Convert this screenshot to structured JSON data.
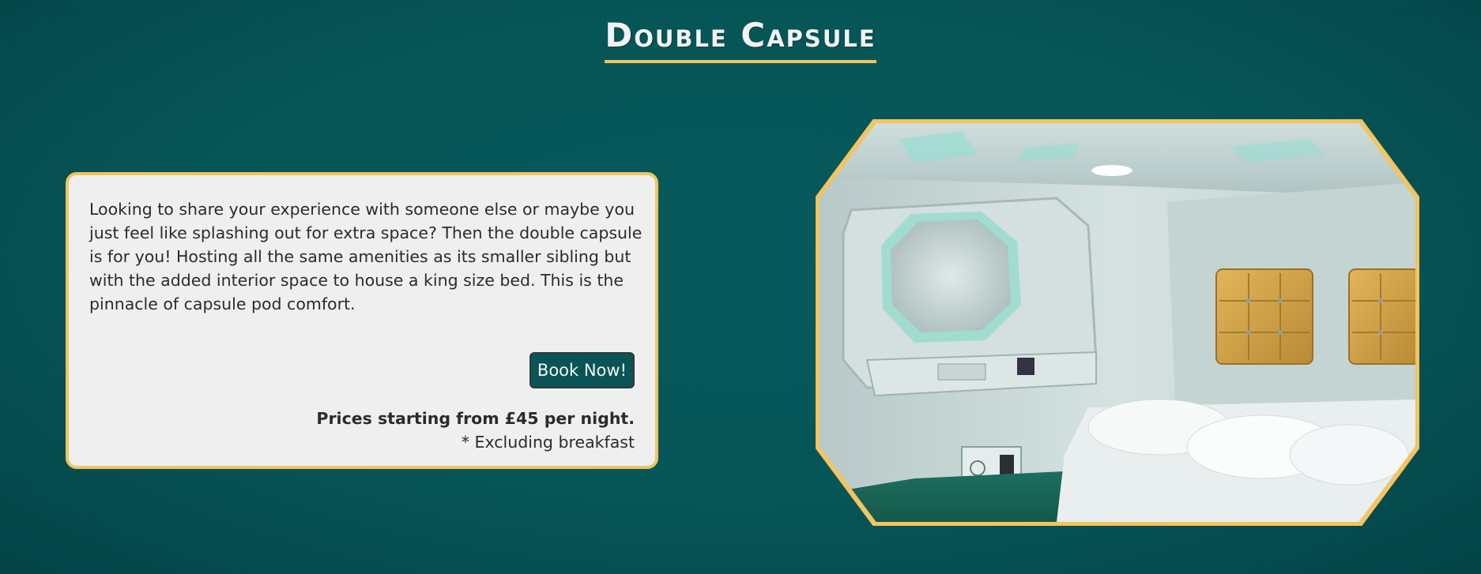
{
  "page": {
    "title": "Double Capsule"
  },
  "card": {
    "description": "Looking to share your experience with someone else or maybe you just feel like splashing out for extra space? Then the double capsule is for you! Hosting all the same amenities as its smaller sibling but with the added interior space to house a king size bed. This is the pinnacle of capsule pod comfort.",
    "book_label": "Book Now!",
    "price_text": "Prices starting from £45 per night.",
    "note_text": "* Excluding breakfast"
  },
  "image": {
    "subject": "capsule-pod-interior-photo",
    "alt": "Double capsule interior"
  },
  "colors": {
    "background": "#065557",
    "accent": "#f3c45f",
    "card": "#efefef",
    "button": "#0b5456"
  }
}
